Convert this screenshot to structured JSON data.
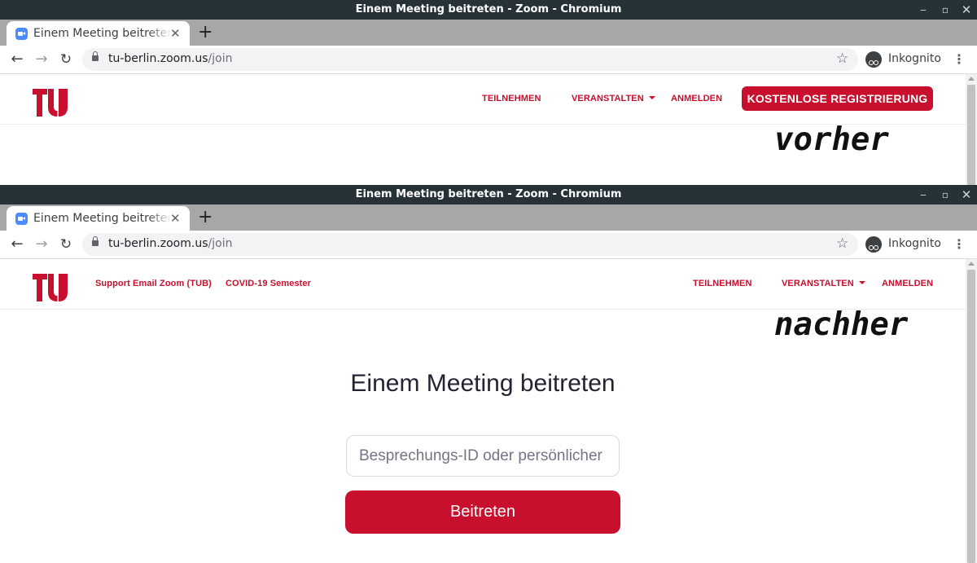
{
  "browser": {
    "window_title": "Einem Meeting beitreten - Zoom - Chromium",
    "tab_title": "Einem Meeting beitreten - Zoom",
    "tab_close": "✕",
    "new_tab": "+",
    "url_domain": "tu-berlin.zoom.us",
    "url_path": "/join",
    "incognito_label": "Inkognito",
    "icons": {
      "back": "←",
      "forward": "→",
      "reload": "↻",
      "star": "☆",
      "menu": "⋮",
      "minimize": "‒",
      "maximize": "▫",
      "close": "✕"
    }
  },
  "before": {
    "label": "vorher",
    "nav": {
      "join": "TEILNEHMEN",
      "host": "VERANSTALTEN",
      "signin": "ANMELDEN",
      "register": "KOSTENLOSE REGISTRIERUNG"
    }
  },
  "after": {
    "label": "nachher",
    "nav": {
      "support": "Support Email Zoom (TUB)",
      "covid": "COVID-19 Semester",
      "join": "TEILNEHMEN",
      "host": "VERANSTALTEN",
      "signin": "ANMELDEN"
    },
    "heading": "Einem Meeting beitreten",
    "meeting_id_placeholder": "Besprechungs-ID oder persönlicher Link-Name",
    "join_button": "Beitreten"
  },
  "colors": {
    "brand_red": "#c8102e",
    "titlebar": "#263238",
    "tabstrip": "#a7a7a7"
  }
}
